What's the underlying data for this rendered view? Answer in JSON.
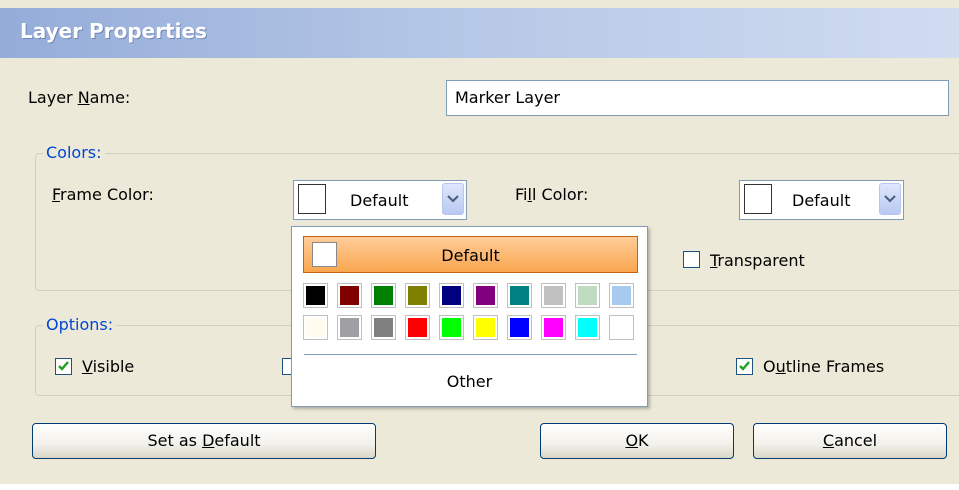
{
  "dialog": {
    "title": "Layer Properties"
  },
  "layer_name": {
    "label_pre": "Layer ",
    "label_key": "N",
    "label_post": "ame:",
    "value": "Marker Layer"
  },
  "colors": {
    "legend": "Colors:",
    "frame": {
      "label_key": "F",
      "label_post": "rame Color:",
      "value": "Default"
    },
    "fill": {
      "label_pre": "Fi",
      "label_key": "l",
      "label_post": "l Color:",
      "value": "Default"
    },
    "transparent": {
      "label_key": "T",
      "label_post": "ransparent",
      "checked": false
    }
  },
  "options": {
    "legend": "Options:",
    "visible": {
      "label_key": "V",
      "label_post": "isible",
      "checked": true
    },
    "outline_frames": {
      "label_pre": "O",
      "label_key": "u",
      "label_post": "tline Frames",
      "checked": true
    }
  },
  "buttons": {
    "set_default": {
      "pre": "Set as ",
      "key": "D",
      "post": "efault"
    },
    "ok": {
      "pre": "",
      "key": "O",
      "post": "K"
    },
    "cancel": {
      "pre": "",
      "key": "C",
      "post": "ancel"
    }
  },
  "color_popup": {
    "default_label": "Default",
    "other_label": "Other",
    "palette_row1": [
      "#000000",
      "#800000",
      "#008000",
      "#808000",
      "#000080",
      "#800080",
      "#008080",
      "#c0c0c0",
      "#c0dcc0",
      "#a6caf0"
    ],
    "palette_row2": [
      "#fffbf0",
      "#a0a0a4",
      "#808080",
      "#ff0000",
      "#00ff00",
      "#ffff00",
      "#0000ff",
      "#ff00ff",
      "#00ffff",
      "#ffffff"
    ]
  }
}
